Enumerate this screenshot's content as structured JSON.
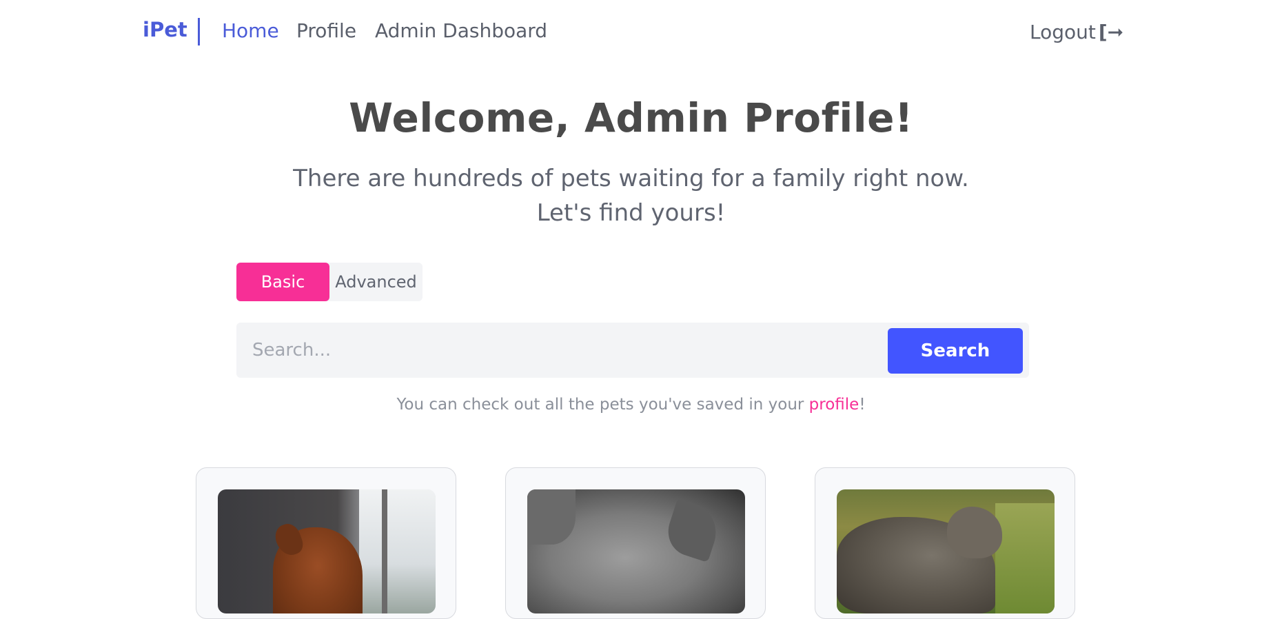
{
  "nav": {
    "brand": "iPet",
    "links": [
      {
        "label": "Home",
        "active": true
      },
      {
        "label": "Profile",
        "active": false
      },
      {
        "label": "Admin Dashboard",
        "active": false
      }
    ],
    "logout_label": "Logout"
  },
  "hero": {
    "title": "Welcome, Admin Profile!",
    "subtitle_line1": "There are hundreds of pets waiting for a family right now.",
    "subtitle_line2": "Let's find yours!"
  },
  "search": {
    "tabs": [
      {
        "label": "Basic",
        "selected": true
      },
      {
        "label": "Advanced",
        "selected": false
      }
    ],
    "placeholder": "Search...",
    "button_label": "Search"
  },
  "hint": {
    "prefix": "You can check out all the pets you've saved in your ",
    "link_text": "profile",
    "suffix": "!"
  },
  "pets": [
    {
      "image": "dog-photo"
    },
    {
      "image": "cat-photo"
    },
    {
      "image": "cat-photo"
    }
  ],
  "colors": {
    "brand": "#4a5bd8",
    "accent_pink": "#f72f96",
    "search_button": "#4255ff"
  }
}
